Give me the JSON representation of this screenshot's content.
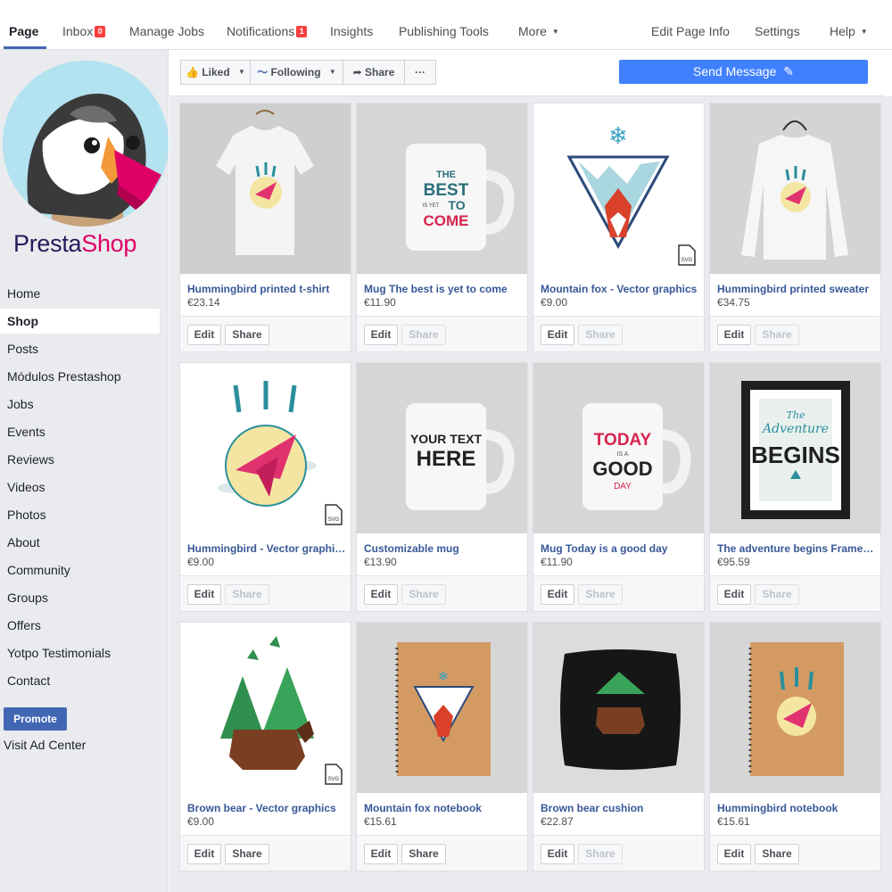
{
  "topnav": {
    "page": "Page",
    "inbox": "Inbox",
    "inbox_count": "0",
    "manage_jobs": "Manage Jobs",
    "notifications": "Notifications",
    "notifications_count": "1",
    "insights": "Insights",
    "publishing_tools": "Publishing Tools",
    "more": "More",
    "edit_page_info": "Edit Page Info",
    "settings": "Settings",
    "help": "Help"
  },
  "brand": {
    "logo_part1": "Presta",
    "logo_part2": "Shop"
  },
  "sidebar": {
    "items": [
      {
        "label": "Home"
      },
      {
        "label": "Shop"
      },
      {
        "label": "Posts"
      },
      {
        "label": "Módulos Prestashop"
      },
      {
        "label": "Jobs"
      },
      {
        "label": "Events"
      },
      {
        "label": "Reviews"
      },
      {
        "label": "Videos"
      },
      {
        "label": "Photos"
      },
      {
        "label": "About"
      },
      {
        "label": "Community"
      },
      {
        "label": "Groups"
      },
      {
        "label": "Offers"
      },
      {
        "label": "Yotpo Testimonials"
      },
      {
        "label": "Contact"
      }
    ],
    "promote": "Promote",
    "ad_center": "Visit Ad Center"
  },
  "actionbar": {
    "liked": "Liked",
    "following": "Following",
    "share": "Share",
    "more": "···",
    "send_message": "Send Message"
  },
  "card_buttons": {
    "edit": "Edit",
    "share": "Share"
  },
  "products": [
    {
      "name": "Hummingbird printed t-shirt",
      "price": "€23.14",
      "share_enabled": true
    },
    {
      "name": "Mug The best is yet to come",
      "price": "€11.90",
      "share_enabled": false
    },
    {
      "name": "Mountain fox - Vector graphics",
      "price": "€9.00",
      "share_enabled": false
    },
    {
      "name": "Hummingbird printed sweater",
      "price": "€34.75",
      "share_enabled": false
    },
    {
      "name": "Hummingbird - Vector graphics",
      "price": "€9.00",
      "share_enabled": false
    },
    {
      "name": "Customizable mug",
      "price": "€13.90",
      "share_enabled": false
    },
    {
      "name": "Mug Today is a good day",
      "price": "€11.90",
      "share_enabled": false
    },
    {
      "name": "The adventure begins Framed…",
      "price": "€95.59",
      "share_enabled": false
    },
    {
      "name": "Brown bear - Vector graphics",
      "price": "€9.00",
      "share_enabled": true
    },
    {
      "name": "Mountain fox notebook",
      "price": "€15.61",
      "share_enabled": true
    },
    {
      "name": "Brown bear cushion",
      "price": "€22.87",
      "share_enabled": false
    },
    {
      "name": "Hummingbird notebook",
      "price": "€15.61",
      "share_enabled": true
    }
  ],
  "artwork": {
    "mug_best": [
      "THE",
      "BEST",
      "IS YET",
      "TO",
      "COME"
    ],
    "mug_custom": [
      "YOUR TEXT",
      "HERE"
    ],
    "mug_today": [
      "TODAY",
      "IS A",
      "GOOD",
      "DAY"
    ],
    "frame": [
      "The",
      "Adventure",
      "BEGINS"
    ],
    "svg_tag": "SVG"
  },
  "colors": {
    "accent": "#4267b2",
    "send_button": "#4080ff",
    "link": "#385898",
    "badge": "#fa3e3e",
    "sidebar_bg": "#e9ebee"
  }
}
